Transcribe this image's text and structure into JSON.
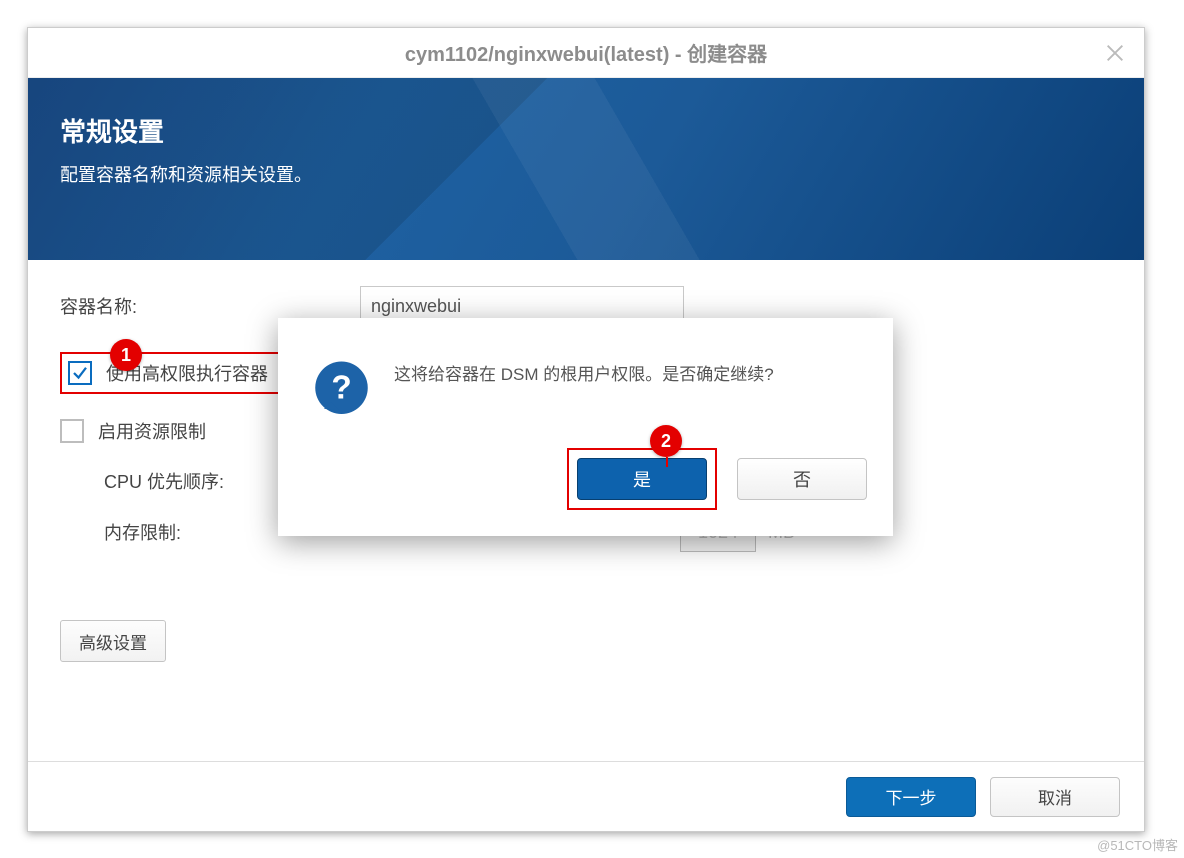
{
  "window": {
    "title": "cym1102/nginxwebui(latest) - 创建容器"
  },
  "banner": {
    "heading": "常规设置",
    "sub": "配置容器名称和资源相关设置。"
  },
  "form": {
    "name_label": "容器名称:",
    "name_value": "nginxwebui",
    "high_priv_label": "使用高权限执行容器",
    "resource_limit_label": "启用资源限制",
    "cpu_label": "CPU 优先顺序:",
    "mem_label": "内存限制:",
    "mem_value": "1024",
    "mem_unit": "MB",
    "advanced": "高级设置"
  },
  "modal": {
    "message": "这将给容器在 DSM 的根用户权限。是否确定继续?",
    "yes": "是",
    "no": "否"
  },
  "footer": {
    "next": "下一步",
    "cancel": "取消"
  },
  "annotations": {
    "a1": "1",
    "a2": "2"
  },
  "watermark": "@51CTO博客"
}
